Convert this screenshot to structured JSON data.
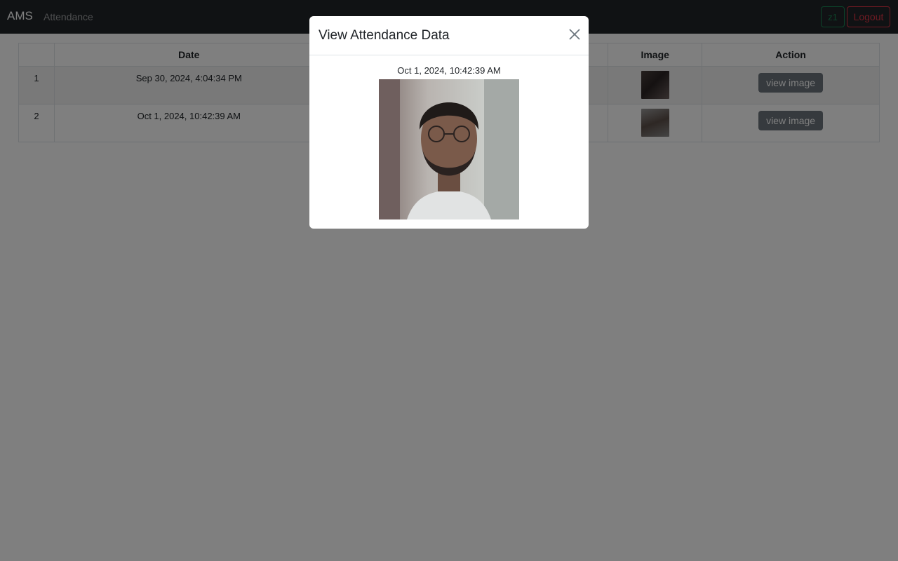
{
  "navbar": {
    "brand": "AMS",
    "link": "Attendance",
    "user_button": "z1",
    "logout_button": "Logout"
  },
  "table": {
    "headers": [
      "",
      "Date",
      "",
      "Image",
      "Action"
    ],
    "rows": [
      {
        "num": "1",
        "date": "Sep 30, 2024, 4:04:34 PM",
        "action": "view image"
      },
      {
        "num": "2",
        "date": "Oct 1, 2024, 10:42:39 AM",
        "action": "view image"
      }
    ]
  },
  "modal": {
    "title": "View Attendance Data",
    "date": "Oct 1, 2024, 10:42:39 AM",
    "close_icon": "close-icon"
  },
  "colors": {
    "navbar_bg": "#212529",
    "success": "#198754",
    "danger": "#dc3545",
    "secondary": "#6c757d"
  }
}
